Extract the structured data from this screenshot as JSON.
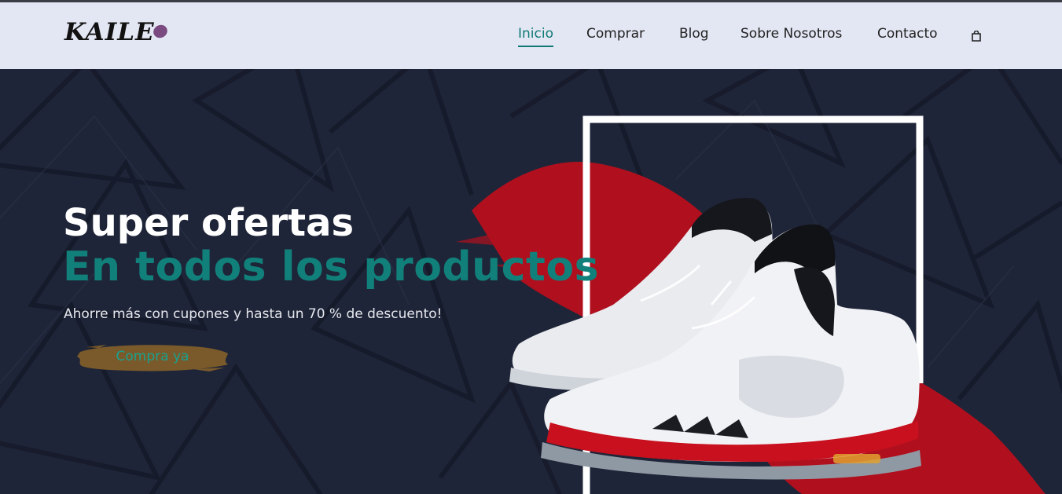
{
  "brand": {
    "logo_text": "KAILE"
  },
  "nav": {
    "items": [
      {
        "label": "Inicio",
        "active": true
      },
      {
        "label": "Comprar",
        "active": false
      },
      {
        "label": "Blog",
        "active": false
      },
      {
        "label": "Sobre Nosotros",
        "active": false
      },
      {
        "label": "Contacto",
        "active": false
      }
    ],
    "cart_icon": "shopping-bag-icon"
  },
  "hero": {
    "title": "Super ofertas",
    "subtitle": "En todos los productos",
    "description": "Ahorre más con cupones y hasta un 70 % de descuento!",
    "cta_label": "Compra ya",
    "image": "sneakers-image"
  },
  "colors": {
    "header_bg": "#e3e6f3",
    "hero_bg": "#1f2538",
    "accent": "#11807a",
    "cta_brush": "#7a5a2a",
    "splash": "#b0101e",
    "logo_dot": "#7a4a80"
  }
}
